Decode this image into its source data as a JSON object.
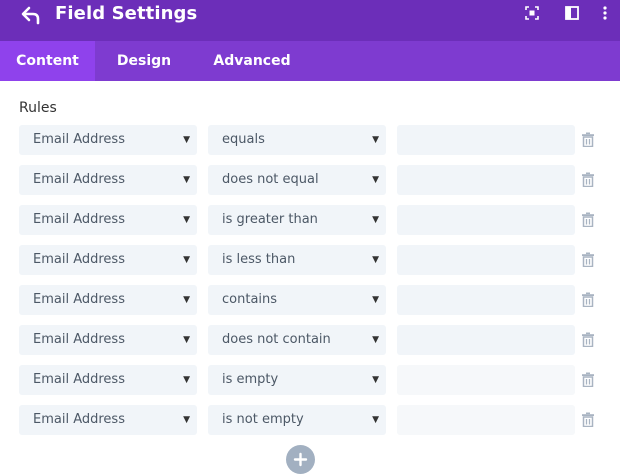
{
  "header": {
    "title": "Field Settings",
    "icons": [
      "back-icon",
      "focus-icon",
      "split-layout-icon",
      "more-vertical-icon"
    ],
    "bg_color": "#6c2eb9"
  },
  "tabs": [
    {
      "label": "Content",
      "active": true
    },
    {
      "label": "Design",
      "active": false
    },
    {
      "label": "Advanced",
      "active": false
    }
  ],
  "rules": {
    "label": "Rules",
    "rows": [
      {
        "field": "Email Address",
        "condition": "equals",
        "value": ""
      },
      {
        "field": "Email Address",
        "condition": "does not equal",
        "value": ""
      },
      {
        "field": "Email Address",
        "condition": "is greater than",
        "value": ""
      },
      {
        "field": "Email Address",
        "condition": "is less than",
        "value": ""
      },
      {
        "field": "Email Address",
        "condition": "contains",
        "value": ""
      },
      {
        "field": "Email Address",
        "condition": "does not contain",
        "value": ""
      },
      {
        "field": "Email Address",
        "condition": "is empty",
        "value": ""
      },
      {
        "field": "Email Address",
        "condition": "is not empty",
        "value": ""
      }
    ],
    "caret_glyph": "▼",
    "row_icon": "trash-icon",
    "add_icon": "plus-icon"
  },
  "colors": {
    "tab_bar": "#7e3bd0",
    "tab_active": "#8f42ec",
    "input_bg": "#f1f5f9",
    "add_button": "#a2b0c1"
  }
}
